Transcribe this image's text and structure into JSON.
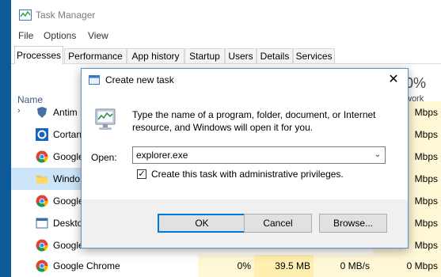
{
  "desktop": {
    "background": "#0b4f86"
  },
  "task_manager": {
    "title": "Task Manager",
    "menu": [
      "File",
      "Options",
      "View"
    ],
    "tabs": [
      "Processes",
      "Performance",
      "App history",
      "Startup",
      "Users",
      "Details",
      "Services"
    ],
    "active_tab": "Processes",
    "columns": {
      "name": "Name",
      "network_pct": "0%",
      "network": "work"
    },
    "processes": [
      {
        "name": "Antim",
        "icon": "shield-icon",
        "net": "Mbps",
        "expand": true
      },
      {
        "name": "Cortan",
        "icon": "cortana-icon",
        "net": "Mbps"
      },
      {
        "name": "Google",
        "icon": "chrome-icon",
        "net": "Mbps"
      },
      {
        "name": "Windo",
        "icon": "folder-icon",
        "net": "Mbps",
        "selected": true
      },
      {
        "name": "Google",
        "icon": "chrome-icon",
        "net": "Mbps"
      },
      {
        "name": "Deskto",
        "icon": "window-icon",
        "net": "Mbps"
      },
      {
        "name": "Google",
        "icon": "chrome-icon",
        "net": "Mbps"
      },
      {
        "name": "Google Chrome",
        "icon": "chrome-icon",
        "cpu": "0%",
        "mem": "39.5 MB",
        "disk": "0 MB/s",
        "net": "0 Mbps"
      }
    ]
  },
  "dialog": {
    "title": "Create new task",
    "description": "Type the name of a program, folder, document, or Internet resource, and Windows will open it for you.",
    "open_label": "Open:",
    "open_value": "explorer.exe",
    "admin_label": "Create this task with administrative privileges.",
    "admin_checked": true,
    "check_mark": "✓",
    "close_glyph": "✕",
    "dropdown_glyph": "⌄",
    "buttons": {
      "ok": "OK",
      "cancel": "Cancel",
      "browse": "Browse..."
    },
    "accent": "#0078d7"
  }
}
